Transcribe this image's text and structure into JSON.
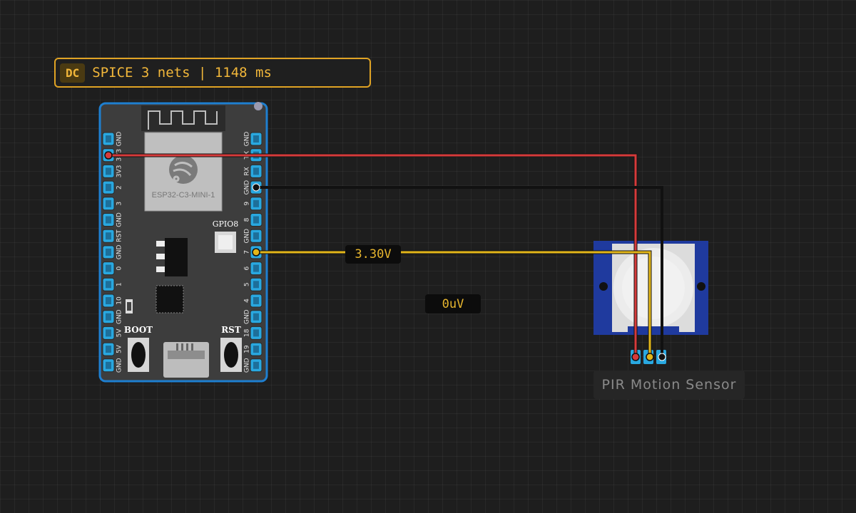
{
  "status": {
    "badge": "DC",
    "text": "SPICE 3 nets | 1148 ms",
    "accent_color": "#e0a324"
  },
  "board": {
    "module_label": "ESP32-C3-MINI-1",
    "led_label": "GPIO8",
    "boot_label": "BOOT",
    "rst_label": "RST",
    "left_pins": [
      "GND",
      "3V3",
      "3V3",
      "2",
      "3",
      "GND",
      "RST",
      "GND",
      "0",
      "1",
      "10",
      "GND",
      "5V",
      "5V",
      "GND"
    ],
    "right_pins": [
      "GND",
      "TX",
      "RX",
      "GND",
      "9",
      "8",
      "GND",
      "7",
      "6",
      "5",
      "4",
      "GND",
      "18",
      "19",
      "GND"
    ]
  },
  "voltages": {
    "vcc": "3.30V",
    "signal": "0uV"
  },
  "sensor": {
    "caption": "PIR Motion Sensor"
  },
  "colors": {
    "wire_power": "#d63a3a",
    "wire_ground": "#111111",
    "wire_signal": "#e3b619",
    "board_outline": "#1e7fd0",
    "pin_pad": "#29a8e0"
  }
}
